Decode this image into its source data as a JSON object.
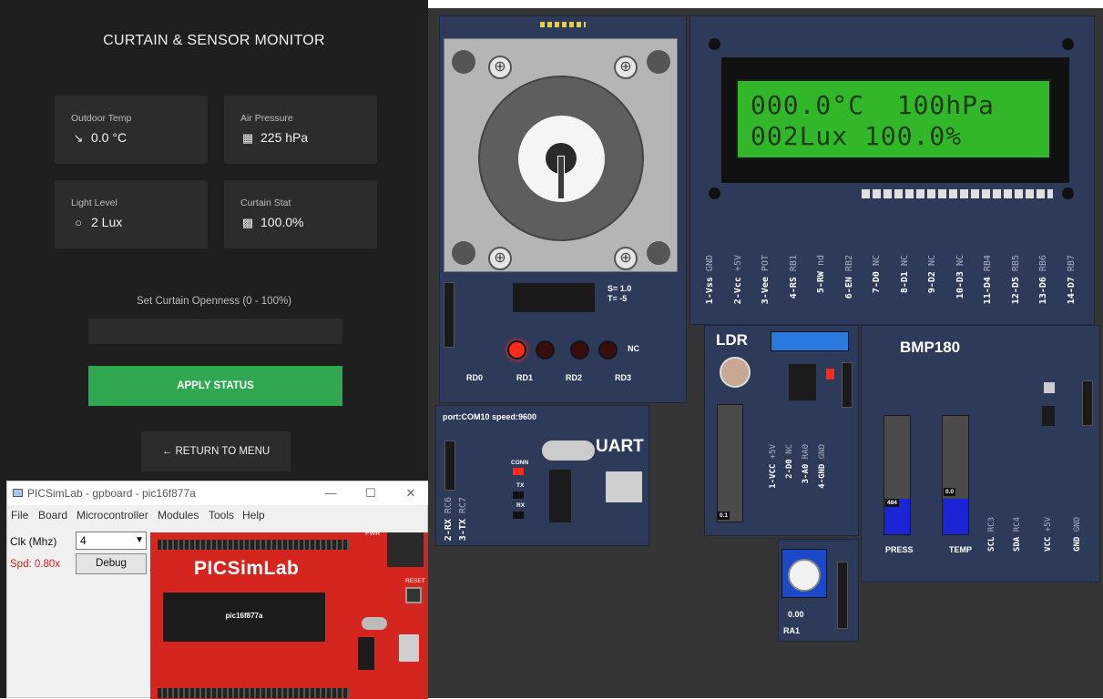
{
  "monitor": {
    "title": "CURTAIN & SENSOR MONITOR",
    "cards": [
      {
        "label": "Outdoor Temp",
        "value": "0.0 °C",
        "icon": "thermometer-icon",
        "glyph": "↘"
      },
      {
        "label": "Air Pressure",
        "value": "225 hPa",
        "icon": "gauge-icon",
        "glyph": "▦"
      },
      {
        "label": "Light Level",
        "value": "2 Lux",
        "icon": "sun-icon",
        "glyph": "○"
      },
      {
        "label": "Curtain Stat",
        "value": "100.0%",
        "icon": "curtain-icon",
        "glyph": "▩"
      }
    ],
    "slider_label": "Set Curtain Openness (0 - 100%)",
    "apply_label": "APPLY STATUS",
    "return_label": "← RETURN TO MENU"
  },
  "picsim": {
    "window_title": "PICSimLab - gpboard - pic16f877a",
    "menu": [
      "File",
      "Board",
      "Microcontroller",
      "Modules",
      "Tools",
      "Help"
    ],
    "clk_label": "Clk (Mhz)",
    "clk_value": "4",
    "speed": "Spd: 0.80x",
    "debug_label": "Debug",
    "board_logo": "PICSimLab",
    "chip_label": "pic16f877a",
    "reset_label": "RESET",
    "pwr_label": "PWR"
  },
  "stepper": {
    "s_value": "S= 1.0",
    "t_value": "T= -5",
    "nc_label": "NC",
    "led_labels": [
      "RD0",
      "RD1",
      "RD2",
      "RD3"
    ],
    "leds_on": [
      true,
      false,
      false,
      false
    ]
  },
  "lcd": {
    "line1": "000.0°C  100hPa",
    "line2": "002Lux 100.0%",
    "pins": [
      {
        "name": "1-Vss",
        "sub": "GND"
      },
      {
        "name": "2-Vcc",
        "sub": "+5V"
      },
      {
        "name": "3-Vee",
        "sub": "POT"
      },
      {
        "name": "4-RS",
        "sub": "RB1"
      },
      {
        "name": "5-RW",
        "sub": "nd"
      },
      {
        "name": "6-EN",
        "sub": "RB2"
      },
      {
        "name": "7-D0",
        "sub": "NC"
      },
      {
        "name": "8-D1",
        "sub": "NC"
      },
      {
        "name": "9-D2",
        "sub": "NC"
      },
      {
        "name": "10-D3",
        "sub": "NC"
      },
      {
        "name": "11-D4",
        "sub": "RB4"
      },
      {
        "name": "12-D5",
        "sub": "RB5"
      },
      {
        "name": "13-D6",
        "sub": "RB6"
      },
      {
        "name": "14-D7",
        "sub": "RB7"
      }
    ]
  },
  "uart": {
    "port_text": "port:COM10  speed:9600",
    "title": "UART",
    "conn_label": "CONN",
    "tx_label": "TX",
    "rx_label": "RX",
    "rx_pin": "2-RX",
    "rx_sub": "RC6",
    "tx_pin": "3-TX",
    "tx_sub": "RC7"
  },
  "ldr": {
    "title": "LDR",
    "value": "0.1",
    "level": 0.0,
    "pins": [
      {
        "name": "1-VCC",
        "sub": "+5V"
      },
      {
        "name": "2-D0",
        "sub": "NC"
      },
      {
        "name": "3-A0",
        "sub": "RA0"
      },
      {
        "name": "4-GND",
        "sub": "GND"
      }
    ]
  },
  "pot": {
    "value": "0.00",
    "label": "RA1"
  },
  "bmp": {
    "title": "BMP180",
    "press_value": "484",
    "press_label": "PRESS",
    "press_level": 0.3,
    "temp_value": "0.0",
    "temp_label": "TEMP",
    "temp_level": 0.3,
    "pins": [
      {
        "name": "SCL",
        "sub": "RC3"
      },
      {
        "name": "SDA",
        "sub": "RC4"
      },
      {
        "name": "VCC",
        "sub": "+5V"
      },
      {
        "name": "GND",
        "sub": "GND"
      }
    ]
  },
  "colors": {
    "accent_green": "#2fa84f",
    "pcb_blue": "#2d3a5a",
    "lcd_green": "#32b62a",
    "board_red": "#d4261f"
  }
}
